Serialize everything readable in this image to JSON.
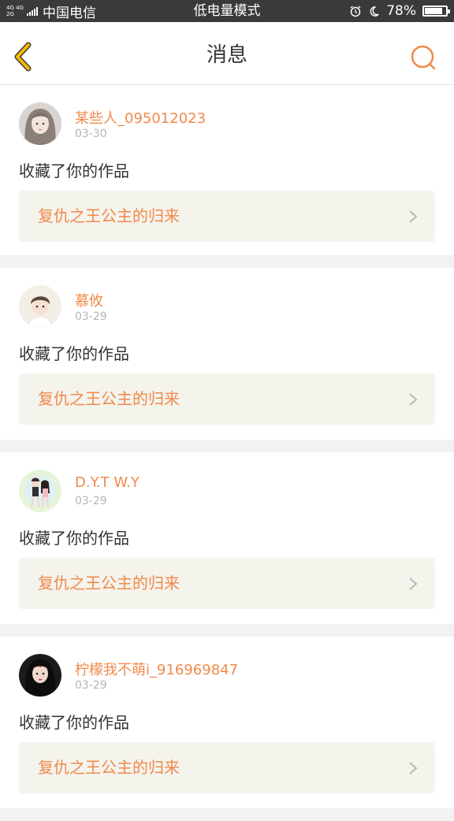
{
  "status_bar": {
    "network_top": "4G 4G",
    "network_bottom": "2G",
    "carrier": "中国电信",
    "mode": "低电量模式",
    "battery_text": "78%",
    "battery_level": 0.78
  },
  "header": {
    "title": "消息",
    "back_icon": "chevron-left-icon",
    "search_icon": "search-icon"
  },
  "colors": {
    "accent": "#f08a4b",
    "back_arrow": "#f5b900"
  },
  "messages": [
    {
      "username": "某些人_095012023",
      "date": "03-30",
      "action": "收藏了你的作品",
      "reference": "复仇之王公主的归来",
      "avatar": "avatar-girl-light-hair"
    },
    {
      "username": "慕攸",
      "date": "03-29",
      "action": "收藏了你的作品",
      "reference": "复仇之王公主的归来",
      "avatar": "avatar-boy-white-shirt"
    },
    {
      "username": "D.Y.T W.Y",
      "date": "03-29",
      "action": "收藏了你的作品",
      "reference": "复仇之王公主的归来",
      "avatar": "avatar-anime-couple"
    },
    {
      "username": "柠檬我不萌i_916969847",
      "date": "03-29",
      "action": "收藏了你的作品",
      "reference": "复仇之王公主的归来",
      "avatar": "avatar-dark-hair-girl"
    }
  ]
}
